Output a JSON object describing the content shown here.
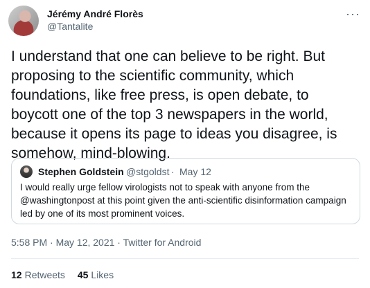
{
  "author": {
    "name": "Jérémy André Florès",
    "handle": "@Tantalite"
  },
  "more_icon": "more-horizontal-icon",
  "tweet": {
    "text": "I understand that one can believe to be right. But proposing to the scientific community, which foundations, like free press, is open debate, to boycott one of the top 3 newspapers in the world, because it opens its page to ideas you disagree, is somehow, mind-blowing."
  },
  "quoted_tweet": {
    "name": "Stephen Goldstein",
    "handle": "@stgoldst",
    "separator": "·",
    "date": "May 12",
    "text": "I would really urge fellow virologists not to speak with anyone from the @washingtonpost at this point given the anti-scientific disinformation campaign led by one of its most prominent voices."
  },
  "meta": {
    "timestamp": "5:58 PM · May 12, 2021 · Twitter for Android"
  },
  "stats": {
    "retweets_count": "12",
    "retweets_label": "Retweets",
    "likes_count": "45",
    "likes_label": "Likes"
  },
  "colors": {
    "primary_text": "#0f1419",
    "secondary_text": "#536471",
    "border": "#cfd9de"
  }
}
